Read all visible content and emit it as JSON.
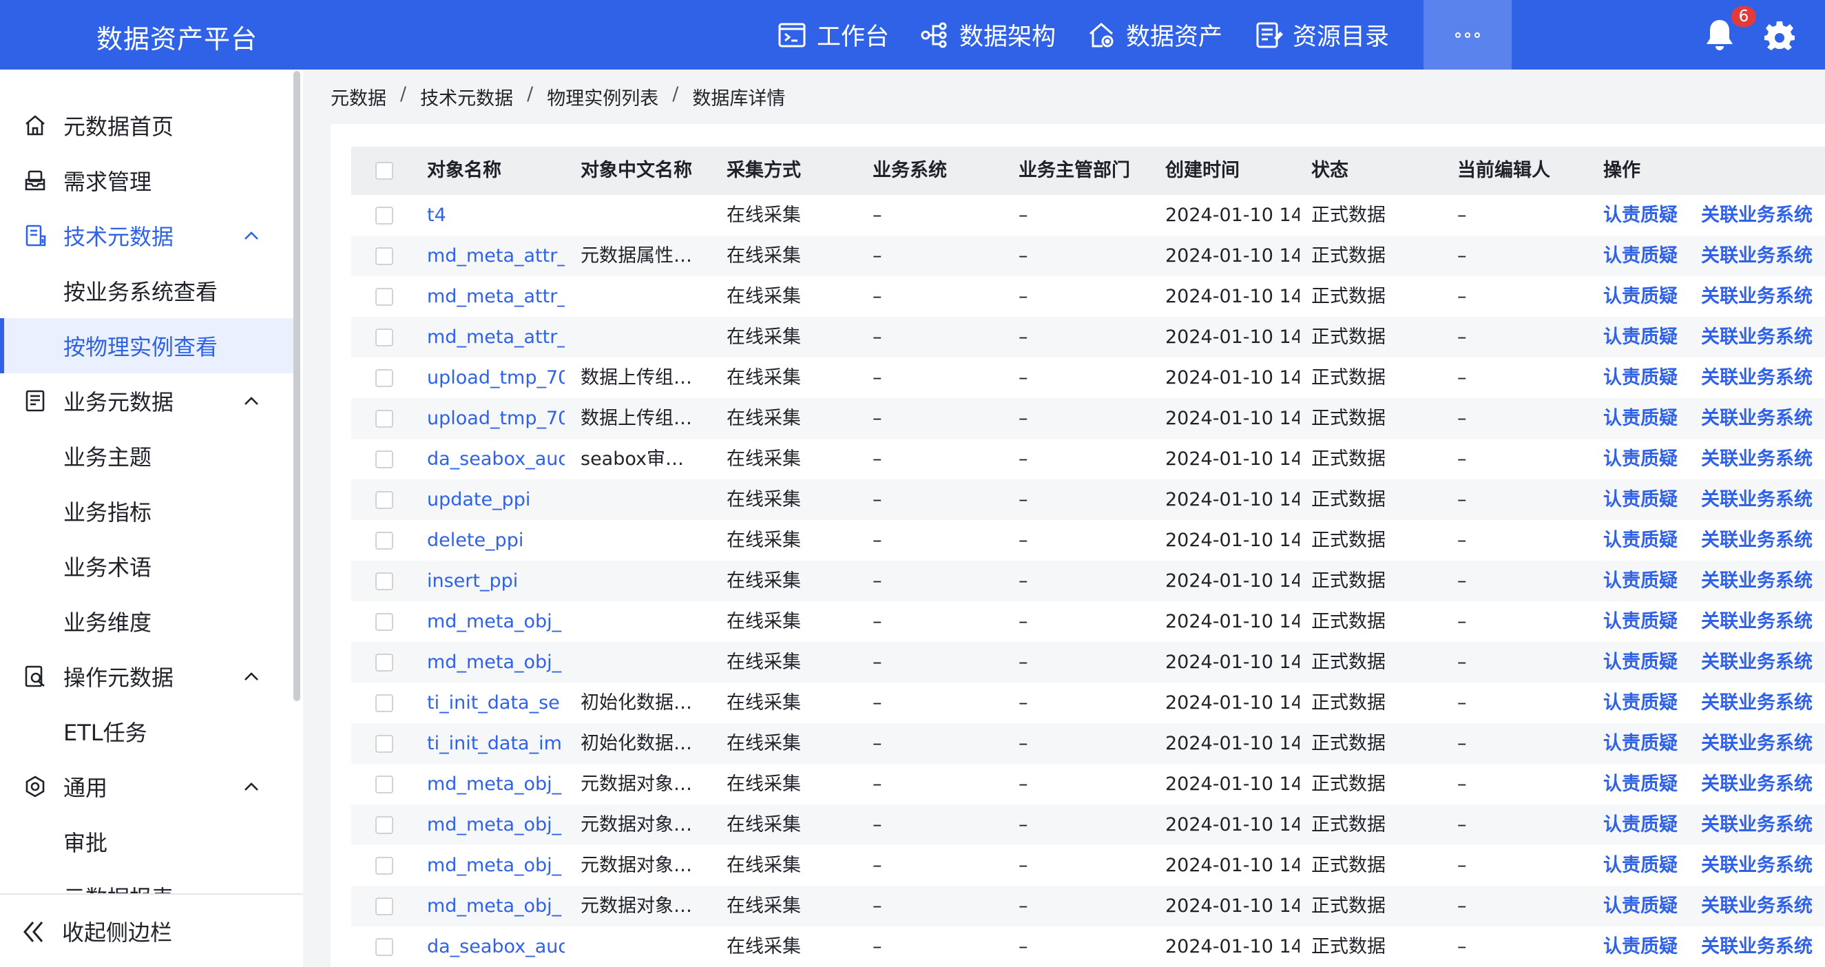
{
  "app": {
    "title": "数据资产平台"
  },
  "nav": [
    {
      "label": "工作台",
      "icon": "terminal-icon"
    },
    {
      "label": "数据架构",
      "icon": "architecture-icon"
    },
    {
      "label": "数据资产",
      "icon": "asset-icon"
    },
    {
      "label": "资源目录",
      "icon": "catalog-icon"
    }
  ],
  "notifications": {
    "count": "6"
  },
  "sidebar": {
    "items": [
      {
        "label": "元数据首页"
      },
      {
        "label": "需求管理"
      },
      {
        "label": "技术元数据"
      },
      {
        "label": "按业务系统查看"
      },
      {
        "label": "按物理实例查看"
      },
      {
        "label": "业务元数据"
      },
      {
        "label": "业务主题"
      },
      {
        "label": "业务指标"
      },
      {
        "label": "业务术语"
      },
      {
        "label": "业务维度"
      },
      {
        "label": "操作元数据"
      },
      {
        "label": "ETL任务"
      },
      {
        "label": "通用"
      },
      {
        "label": "审批"
      },
      {
        "label": "元数据报表"
      }
    ],
    "collapse_label": "收起侧边栏"
  },
  "breadcrumb": [
    "元数据",
    "技术元数据",
    "物理实例列表",
    "数据库详情"
  ],
  "table": {
    "columns": {
      "name": "对象名称",
      "cn_name": "对象中文名称",
      "method": "采集方式",
      "system": "业务系统",
      "dept": "业务主管部门",
      "created": "创建时间",
      "status": "状态",
      "editor": "当前编辑人",
      "ops": "操作"
    },
    "rows": [
      {
        "name": "t4",
        "cn_name": "",
        "method": "在线采集",
        "system": "–",
        "dept": "–",
        "created": "2024-01-10 14",
        "status": "正式数据",
        "editor": "–",
        "op1": "认责质疑",
        "op2": "关联业务系统"
      },
      {
        "name": "md_meta_attr_",
        "cn_name": "元数据属性…",
        "method": "在线采集",
        "system": "–",
        "dept": "–",
        "created": "2024-01-10 14",
        "status": "正式数据",
        "editor": "–",
        "op1": "认责质疑",
        "op2": "关联业务系统"
      },
      {
        "name": "md_meta_attr_",
        "cn_name": "",
        "method": "在线采集",
        "system": "–",
        "dept": "–",
        "created": "2024-01-10 14",
        "status": "正式数据",
        "editor": "–",
        "op1": "认责质疑",
        "op2": "关联业务系统"
      },
      {
        "name": "md_meta_attr_",
        "cn_name": "",
        "method": "在线采集",
        "system": "–",
        "dept": "–",
        "created": "2024-01-10 14",
        "status": "正式数据",
        "editor": "–",
        "op1": "认责质疑",
        "op2": "关联业务系统"
      },
      {
        "name": "upload_tmp_70",
        "cn_name": "数据上传组…",
        "method": "在线采集",
        "system": "–",
        "dept": "–",
        "created": "2024-01-10 14",
        "status": "正式数据",
        "editor": "–",
        "op1": "认责质疑",
        "op2": "关联业务系统"
      },
      {
        "name": "upload_tmp_70",
        "cn_name": "数据上传组…",
        "method": "在线采集",
        "system": "–",
        "dept": "–",
        "created": "2024-01-10 14",
        "status": "正式数据",
        "editor": "–",
        "op1": "认责质疑",
        "op2": "关联业务系统"
      },
      {
        "name": "da_seabox_auc",
        "cn_name": "seabox审…",
        "method": "在线采集",
        "system": "–",
        "dept": "–",
        "created": "2024-01-10 14",
        "status": "正式数据",
        "editor": "–",
        "op1": "认责质疑",
        "op2": "关联业务系统"
      },
      {
        "name": "update_ppi",
        "cn_name": "",
        "method": "在线采集",
        "system": "–",
        "dept": "–",
        "created": "2024-01-10 14",
        "status": "正式数据",
        "editor": "–",
        "op1": "认责质疑",
        "op2": "关联业务系统"
      },
      {
        "name": "delete_ppi",
        "cn_name": "",
        "method": "在线采集",
        "system": "–",
        "dept": "–",
        "created": "2024-01-10 14",
        "status": "正式数据",
        "editor": "–",
        "op1": "认责质疑",
        "op2": "关联业务系统"
      },
      {
        "name": "insert_ppi",
        "cn_name": "",
        "method": "在线采集",
        "system": "–",
        "dept": "–",
        "created": "2024-01-10 14",
        "status": "正式数据",
        "editor": "–",
        "op1": "认责质疑",
        "op2": "关联业务系统"
      },
      {
        "name": "md_meta_obj_",
        "cn_name": "",
        "method": "在线采集",
        "system": "–",
        "dept": "–",
        "created": "2024-01-10 14",
        "status": "正式数据",
        "editor": "–",
        "op1": "认责质疑",
        "op2": "关联业务系统"
      },
      {
        "name": "md_meta_obj_",
        "cn_name": "",
        "method": "在线采集",
        "system": "–",
        "dept": "–",
        "created": "2024-01-10 14",
        "status": "正式数据",
        "editor": "–",
        "op1": "认责质疑",
        "op2": "关联业务系统"
      },
      {
        "name": "ti_init_data_se",
        "cn_name": "初始化数据…",
        "method": "在线采集",
        "system": "–",
        "dept": "–",
        "created": "2024-01-10 14",
        "status": "正式数据",
        "editor": "–",
        "op1": "认责质疑",
        "op2": "关联业务系统"
      },
      {
        "name": "ti_init_data_im",
        "cn_name": "初始化数据…",
        "method": "在线采集",
        "system": "–",
        "dept": "–",
        "created": "2024-01-10 14",
        "status": "正式数据",
        "editor": "–",
        "op1": "认责质疑",
        "op2": "关联业务系统"
      },
      {
        "name": "md_meta_obj_",
        "cn_name": "元数据对象…",
        "method": "在线采集",
        "system": "–",
        "dept": "–",
        "created": "2024-01-10 14",
        "status": "正式数据",
        "editor": "–",
        "op1": "认责质疑",
        "op2": "关联业务系统"
      },
      {
        "name": "md_meta_obj_",
        "cn_name": "元数据对象…",
        "method": "在线采集",
        "system": "–",
        "dept": "–",
        "created": "2024-01-10 14",
        "status": "正式数据",
        "editor": "–",
        "op1": "认责质疑",
        "op2": "关联业务系统"
      },
      {
        "name": "md_meta_obj_",
        "cn_name": "元数据对象…",
        "method": "在线采集",
        "system": "–",
        "dept": "–",
        "created": "2024-01-10 14",
        "status": "正式数据",
        "editor": "–",
        "op1": "认责质疑",
        "op2": "关联业务系统"
      },
      {
        "name": "md_meta_obj_",
        "cn_name": "元数据对象…",
        "method": "在线采集",
        "system": "–",
        "dept": "–",
        "created": "2024-01-10 14",
        "status": "正式数据",
        "editor": "–",
        "op1": "认责质疑",
        "op2": "关联业务系统"
      },
      {
        "name": "da_seabox_auc",
        "cn_name": "",
        "method": "在线采集",
        "system": "–",
        "dept": "–",
        "created": "2024-01-10 14",
        "status": "正式数据",
        "editor": "–",
        "op1": "认责质疑",
        "op2": "关联业务系统"
      }
    ]
  },
  "colors": {
    "primary": "#2f62e6",
    "badge": "#e33b3b",
    "selected_bg": "#eaf0fd"
  }
}
